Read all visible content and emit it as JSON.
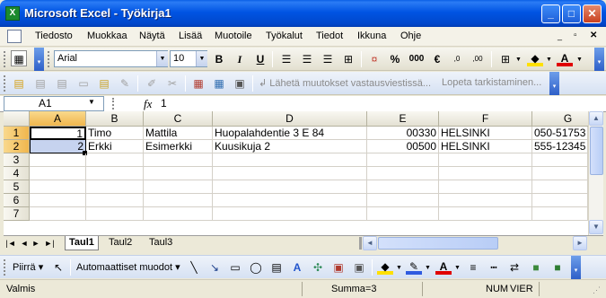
{
  "window": {
    "title": "Microsoft Excel - Työkirja1",
    "app_icon": "excel-icon"
  },
  "menu": {
    "items": [
      "Tiedosto",
      "Muokkaa",
      "Näytä",
      "Lisää",
      "Muotoile",
      "Työkalut",
      "Tiedot",
      "Ikkuna",
      "Ohje"
    ]
  },
  "format_toolbar": {
    "font": "Arial",
    "size": "10",
    "bold": "B",
    "italic": "I",
    "underline": "U",
    "percent": "%",
    "thousands": "000",
    "currency": "€"
  },
  "review_toolbar": {
    "send_changes": "Lähetä muutokset vastausviestissä...",
    "end_review": "Lopeta tarkistaminen..."
  },
  "formula_bar": {
    "name_box": "A1",
    "fx": "fx",
    "value": "1"
  },
  "grid": {
    "columns": [
      "A",
      "B",
      "C",
      "D",
      "E",
      "F",
      "G"
    ],
    "rows": [
      "1",
      "2",
      "3",
      "4",
      "5",
      "6",
      "7"
    ],
    "data": [
      [
        "1",
        "Timo",
        "Mattila",
        "Huopalahdentie 3 E 84",
        "00330",
        "HELSINKI",
        "050-51753"
      ],
      [
        "2",
        "Erkki",
        "Esimerkki",
        "Kuusikuja 2",
        "00500",
        "HELSINKI",
        "555-12345"
      ]
    ]
  },
  "sheets": {
    "tabs": [
      "Taul1",
      "Taul2",
      "Taul3"
    ],
    "active": "Taul1"
  },
  "drawing_toolbar": {
    "draw": "Piirrä",
    "autoshapes": "Automaattiset muodot"
  },
  "status": {
    "mode": "Valmis",
    "sum": "Summa=3",
    "num": "NUM",
    "ext": "VIER"
  }
}
